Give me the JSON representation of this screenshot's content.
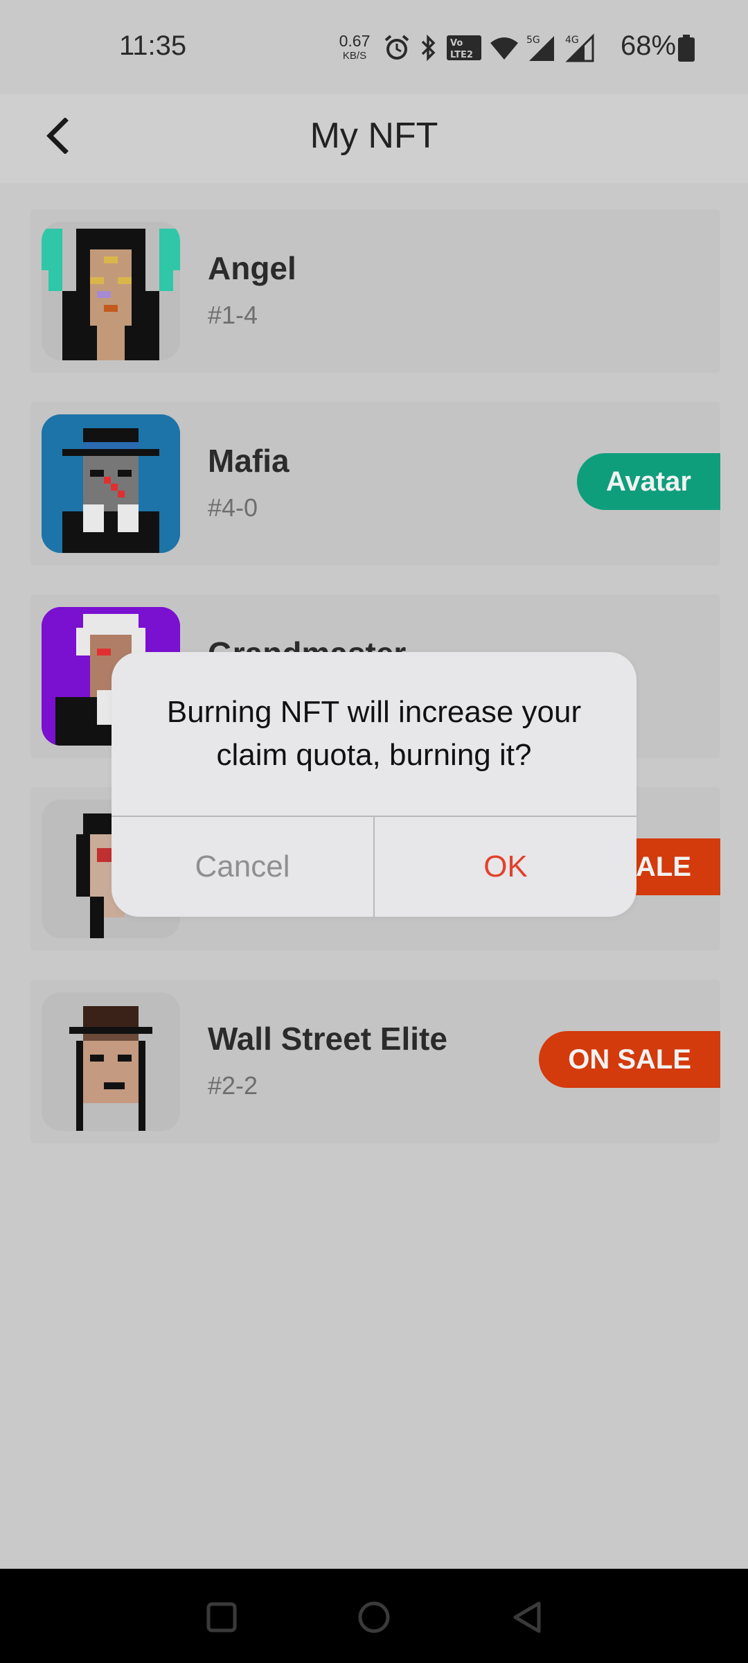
{
  "status_bar": {
    "time": "11:35",
    "net_speed_value": "0.67",
    "net_speed_unit": "KB/S",
    "icons": [
      "alarm-icon",
      "bluetooth-icon",
      "volte-icon",
      "wifi-icon",
      "signal-5g-icon",
      "signal-4g-icon"
    ],
    "net_5g": "5G",
    "net_4g": "4G",
    "battery_percent": "68%"
  },
  "header": {
    "title": "My NFT",
    "back_icon": "back-arrow-icon"
  },
  "nft_list": [
    {
      "name": "Angel",
      "id": "#1-4",
      "badge": ""
    },
    {
      "name": "Mafia",
      "id": "#4-0",
      "badge": "Avatar",
      "badge_color": "#0f9e7c"
    },
    {
      "name": "Grandmaster",
      "id": "",
      "badge": ""
    },
    {
      "name": "",
      "id": "",
      "badge": "ON SALE",
      "badge_color": "#d33a0c"
    },
    {
      "name": "Wall Street Elite",
      "id": "#2-2",
      "badge": "ON SALE",
      "badge_color": "#d33a0c"
    }
  ],
  "dialog": {
    "message": "Burning NFT will increase your claim quota, burning it?",
    "cancel_label": "Cancel",
    "ok_label": "OK",
    "ok_color": "#e2412b"
  },
  "nav_bar": {
    "icons": [
      "recents-square-icon",
      "home-circle-icon",
      "back-triangle-icon"
    ]
  }
}
